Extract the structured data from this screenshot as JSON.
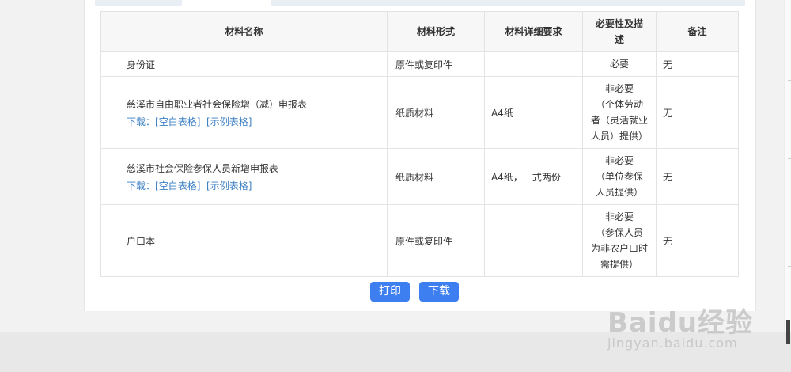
{
  "table": {
    "headers": [
      "材料名称",
      "材料形式",
      "材料详细要求",
      "必要性及描述",
      "备注"
    ],
    "rows": [
      {
        "name": "身份证",
        "links": null,
        "form": "原件或复印件",
        "detail": "",
        "necessity": "必要",
        "note": "无"
      },
      {
        "name": "慈溪市自由职业者社会保险增（减）申报表",
        "links": {
          "prefix": "下载：",
          "blank": "[空白表格]",
          "sample": "[示例表格]"
        },
        "form": "纸质材料",
        "detail": "A4纸",
        "necessity": "非必要\n（个体劳动\n者（灵活就业\n人员）提供）",
        "note": "无"
      },
      {
        "name": "慈溪市社会保险参保人员新增申报表",
        "links": {
          "prefix": "下载：",
          "blank": "[空白表格]",
          "sample": "[示例表格]"
        },
        "form": "纸质材料",
        "detail": "A4纸，一式两份",
        "necessity": "非必要\n（单位参保\n人员提供）",
        "note": "无"
      },
      {
        "name": "户口本",
        "links": null,
        "form": "原件或复印件",
        "detail": "",
        "necessity": "非必要\n（参保人员\n为非农户口时\n需提供）",
        "note": "无"
      }
    ]
  },
  "buttons": {
    "print": "打印",
    "download": "下载"
  },
  "watermark": {
    "logo": "Baidu经验",
    "url": "jingyan.baidu.com"
  },
  "colors": {
    "accent": "#3d7ff0",
    "link": "#3b7fc4"
  }
}
